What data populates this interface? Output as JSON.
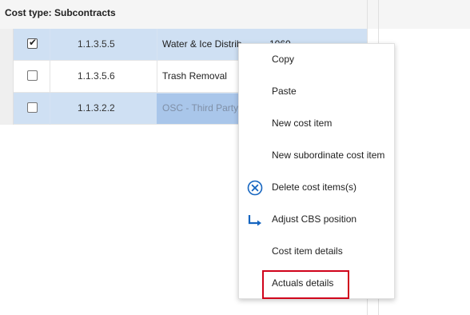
{
  "group": {
    "label": "Cost type: Subcontracts"
  },
  "rows": [
    {
      "code": "1.1.3.5.5",
      "description": "Water & Ice Distrib",
      "trailing": "1060",
      "checked": true,
      "state": "selected"
    },
    {
      "code": "1.1.3.5.6",
      "description": "Trash Removal",
      "trailing": "",
      "checked": false,
      "state": "normal"
    },
    {
      "code": "1.1.3.2.2",
      "description": "OSC - Third Party",
      "trailing": "",
      "checked": false,
      "state": "editing"
    }
  ],
  "context_menu": {
    "items": [
      {
        "label": "Copy",
        "icon": ""
      },
      {
        "label": "Paste",
        "icon": ""
      },
      {
        "label": "New cost item",
        "icon": ""
      },
      {
        "label": "New subordinate cost item",
        "icon": ""
      },
      {
        "label": "Delete cost items(s)",
        "icon": "delete-circle-icon"
      },
      {
        "label": "Adjust CBS position",
        "icon": "adjust-arrow-icon"
      },
      {
        "label": "Cost item details",
        "icon": ""
      },
      {
        "label": "Actuals details",
        "icon": "",
        "highlighted": true
      }
    ]
  },
  "colors": {
    "selected_row": "#cfe0f3",
    "editing_cell": "#a9c6ea",
    "icon_blue": "#1565c0",
    "highlight_red": "#d0021b"
  }
}
